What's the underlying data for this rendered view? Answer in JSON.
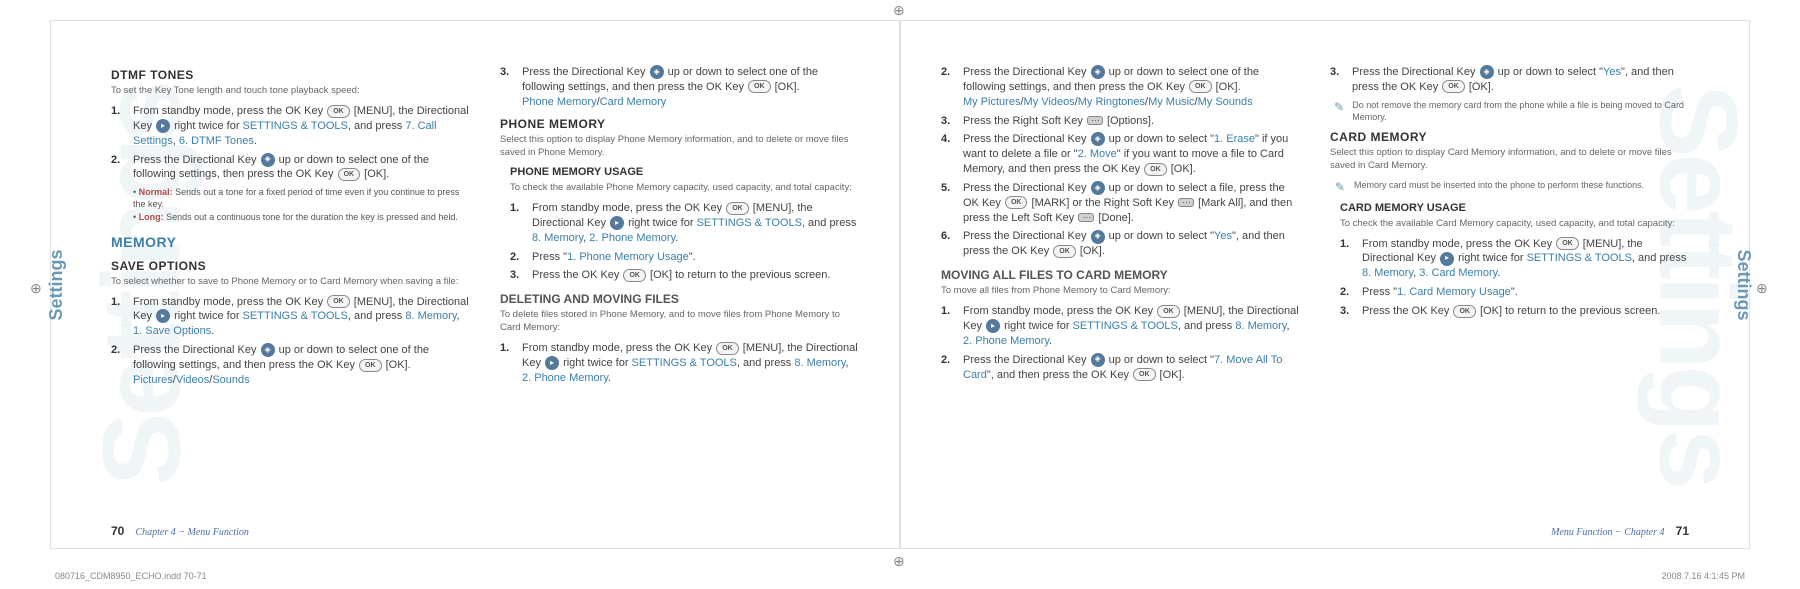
{
  "ghost_label": "Settings",
  "side_tab": "Settings",
  "left_page": {
    "col1": {
      "h_dtmf": "DTMF TONES",
      "dtmf_desc": "To set the Key Tone length and touch tone playback speed:",
      "dtmf_steps": {
        "s1a": "From standby mode, press the OK Key ",
        "s1b": " [MENU], the Directional Key ",
        "s1c": " right twice for ",
        "s1_link1": "SETTINGS & TOOLS",
        "s1d": ", and press ",
        "s1_link2": "7. Call Settings",
        "s1e": ", ",
        "s1_link3": "6. DTMF Tones",
        "s1f": ".",
        "s2a": "Press the Directional Key ",
        "s2b": " up or down to select one of the following settings, then press the OK Key ",
        "s2c": " [OK]."
      },
      "bullet_normal_label": "Normal:",
      "bullet_normal_text": "  Sends out a tone for a fixed period of time even if you continue to press the key.",
      "bullet_long_label": "Long:",
      "bullet_long_text": "  Sends out a continuous tone for the duration the key is pressed and held.",
      "h_memory": "MEMORY",
      "h_save": "SAVE OPTIONS",
      "save_desc": "To select whether to save to Phone Memory or to Card Memory when saving a file:",
      "save_steps": {
        "s1a": "From standby mode, press the OK Key ",
        "s1b": " [MENU], the Directional Key ",
        "s1c": " right twice for ",
        "s1_link1": "SETTINGS & TOOLS",
        "s1d": ", and press ",
        "s1_link2": "8. Memory",
        "s1e": ", ",
        "s1_link3": "1. Save Options",
        "s1f": ".",
        "s2a": "Press the Directional Key ",
        "s2b": " up or down to select one of the following settings, and then press the OK Key ",
        "s2c": " [OK].",
        "s2_opts_a": "Pictures",
        "s2_sep": "/",
        "s2_opts_b": "Videos",
        "s2_opts_c": "Sounds"
      }
    },
    "col2": {
      "top_step": {
        "num": "3.",
        "a": "Press the Directional Key ",
        "b": " up or down to select one of the following settings, and then press the OK Key ",
        "c": " [OK].",
        "opt_a": "Phone Memory",
        "sep": "/",
        "opt_b": "Card Memory"
      },
      "h_phone": "PHONE MEMORY",
      "phone_desc": "Select this option to display Phone Memory information, and to delete or move files saved in Phone Memory.",
      "h_usage": "PHONE MEMORY USAGE",
      "usage_desc": "To check the available Phone Memory capacity, used capacity, and total capacity:",
      "usage_steps": {
        "s1a": "From standby mode, press the OK Key ",
        "s1b": " [MENU], the Directional Key ",
        "s1c": " right twice for ",
        "s1_link1": "SETTINGS & TOOLS",
        "s1d": ", and press ",
        "s1_link2": "8. Memory",
        "s1e": ", ",
        "s1_link3": "2. Phone Memory",
        "s1f": ".",
        "s2a": "Press \"",
        "s2_link": "1. Phone Memory Usage",
        "s2b": "\".",
        "s3a": "Press the OK Key ",
        "s3b": " [OK] to return to the previous screen."
      },
      "h_delmove": "DELETING AND MOVING FILES",
      "delmove_desc": "To delete files stored in Phone Memory, and to move files from Phone Memory to Card Memory:",
      "delmove_steps": {
        "s1a": "From standby mode, press the OK Key ",
        "s1b": " [MENU], the Directional Key ",
        "s1c": " right twice for ",
        "s1_link1": "SETTINGS & TOOLS",
        "s1d": ", and press ",
        "s1_link2": "8. Memory",
        "s1e": ", ",
        "s1_link3": "2. Phone Memory",
        "s1f": "."
      }
    },
    "footer_page": "70",
    "footer_chapter": "Chapter 4 − Menu Function"
  },
  "right_page": {
    "col1": {
      "steps": {
        "s2a": "Press the Directional Key ",
        "s2b": " up or down to select one of the following settings, and then press the OK Key ",
        "s2c": " [OK].",
        "s2_opt_a": "My Pictures",
        "sep": "/",
        "s2_opt_b": "My Videos",
        "s2_opt_c": "My Ringtones",
        "s2_opt_d": "My Music",
        "s2_opt_e": "My Sounds",
        "s3a": "Press the Right Soft Key ",
        "s3b": " [Options].",
        "s4a": "Press the Directional Key ",
        "s4b": " up or down to select \"",
        "s4_link1": "1. Erase",
        "s4c": "\" if you want to delete a file or \"",
        "s4_link2": "2. Move",
        "s4d": "\" if you want to move a file to Card Memory, and then press the OK Key ",
        "s4e": " [OK].",
        "s5a": "Press the Directional Key ",
        "s5b": " up or down to select a file, press the OK Key ",
        "s5c": " [MARK] or the Right Soft Key ",
        "s5d": " [Mark All], and then press the Left Soft Key ",
        "s5e": " [Done].",
        "s6a": "Press the Directional Key ",
        "s6b": " up or down to select \"",
        "s6_link": "Yes",
        "s6c": "\", and then press the OK Key ",
        "s6d": " [OK]."
      },
      "h_moveall": "MOVING ALL FILES TO CARD MEMORY",
      "moveall_desc": "To move all files from Phone Memory to Card Memory:",
      "moveall_steps": {
        "s1a": "From standby mode, press the OK Key ",
        "s1b": " [MENU], the Directional Key ",
        "s1c": " right twice for ",
        "s1_link1": "SETTINGS & TOOLS",
        "s1d": ", and press ",
        "s1_link2": "8. Memory",
        "s1e": ", ",
        "s1_link3": "2. Phone Memory",
        "s1f": ".",
        "s2a": "Press the Directional Key ",
        "s2b": " up or down to select \"",
        "s2_link": "7. Move All To Card",
        "s2c": "\", and then press the OK Key ",
        "s2d": " [OK]."
      }
    },
    "col2": {
      "top_step": {
        "a": "Press the Directional Key ",
        "b": " up or down to select \"",
        "link": "Yes",
        "c": "\", and then press the OK Key ",
        "d": " [OK]."
      },
      "note1": "Do not remove the memory card from the phone while a file is being moved to Card Memory.",
      "h_card": "CARD MEMORY",
      "card_desc": "Select this option to display Card Memory information, and to delete or move files saved in Card Memory.",
      "note2": "Memory card must be inserted into the phone to perform these functions.",
      "h_cardusage": "CARD MEMORY USAGE",
      "cardusage_desc": "To check the available Card Memory capacity, used capacity, and total capacity:",
      "cardusage_steps": {
        "s1a": "From standby mode, press the OK Key ",
        "s1b": " [MENU], the Directional Key ",
        "s1c": " right twice for ",
        "s1_link1": "SETTINGS & TOOLS",
        "s1d": ", and press ",
        "s1_link2": "8. Memory",
        "s1e": ", ",
        "s1_link3": "3. Card Memory",
        "s1f": ".",
        "s2a": "Press \"",
        "s2_link": "1. Card Memory Usage",
        "s2b": "\".",
        "s3a": "Press the OK Key ",
        "s3b": " [OK] to return to the previous screen."
      }
    },
    "footer_chapter": "Menu Function − Chapter 4",
    "footer_page": "71"
  },
  "imprint_left": "080716_CDM8950_ECHO.indd   70-71",
  "imprint_right": "2008.7.16   4:1:45 PM"
}
